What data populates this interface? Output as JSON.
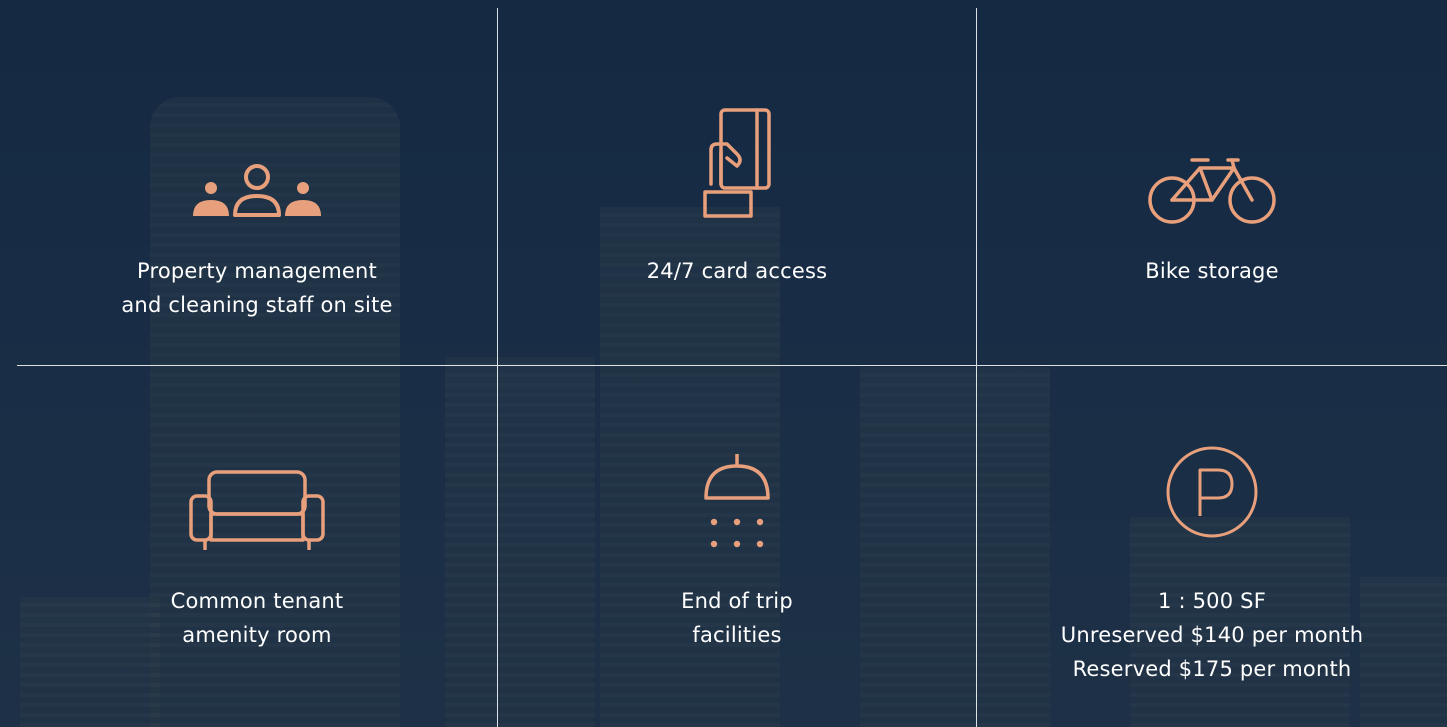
{
  "colors": {
    "accent": "#e8a07c",
    "text": "#ffffff",
    "divider": "#ffffff",
    "background": "#17314d"
  },
  "amenities": [
    {
      "icon": "staff-group-icon",
      "lines": [
        "Property management",
        "and cleaning staff on site"
      ]
    },
    {
      "icon": "card-access-icon",
      "lines": [
        "24/7 card access"
      ]
    },
    {
      "icon": "bike-icon",
      "lines": [
        "Bike storage"
      ]
    },
    {
      "icon": "sofa-icon",
      "lines": [
        "Common tenant",
        "amenity room"
      ]
    },
    {
      "icon": "shower-icon",
      "lines": [
        "End of trip",
        "facilities"
      ]
    },
    {
      "icon": "parking-icon",
      "lines": [
        "1 : 500 SF",
        "Unreserved $140 per month",
        "Reserved $175 per month"
      ]
    }
  ]
}
